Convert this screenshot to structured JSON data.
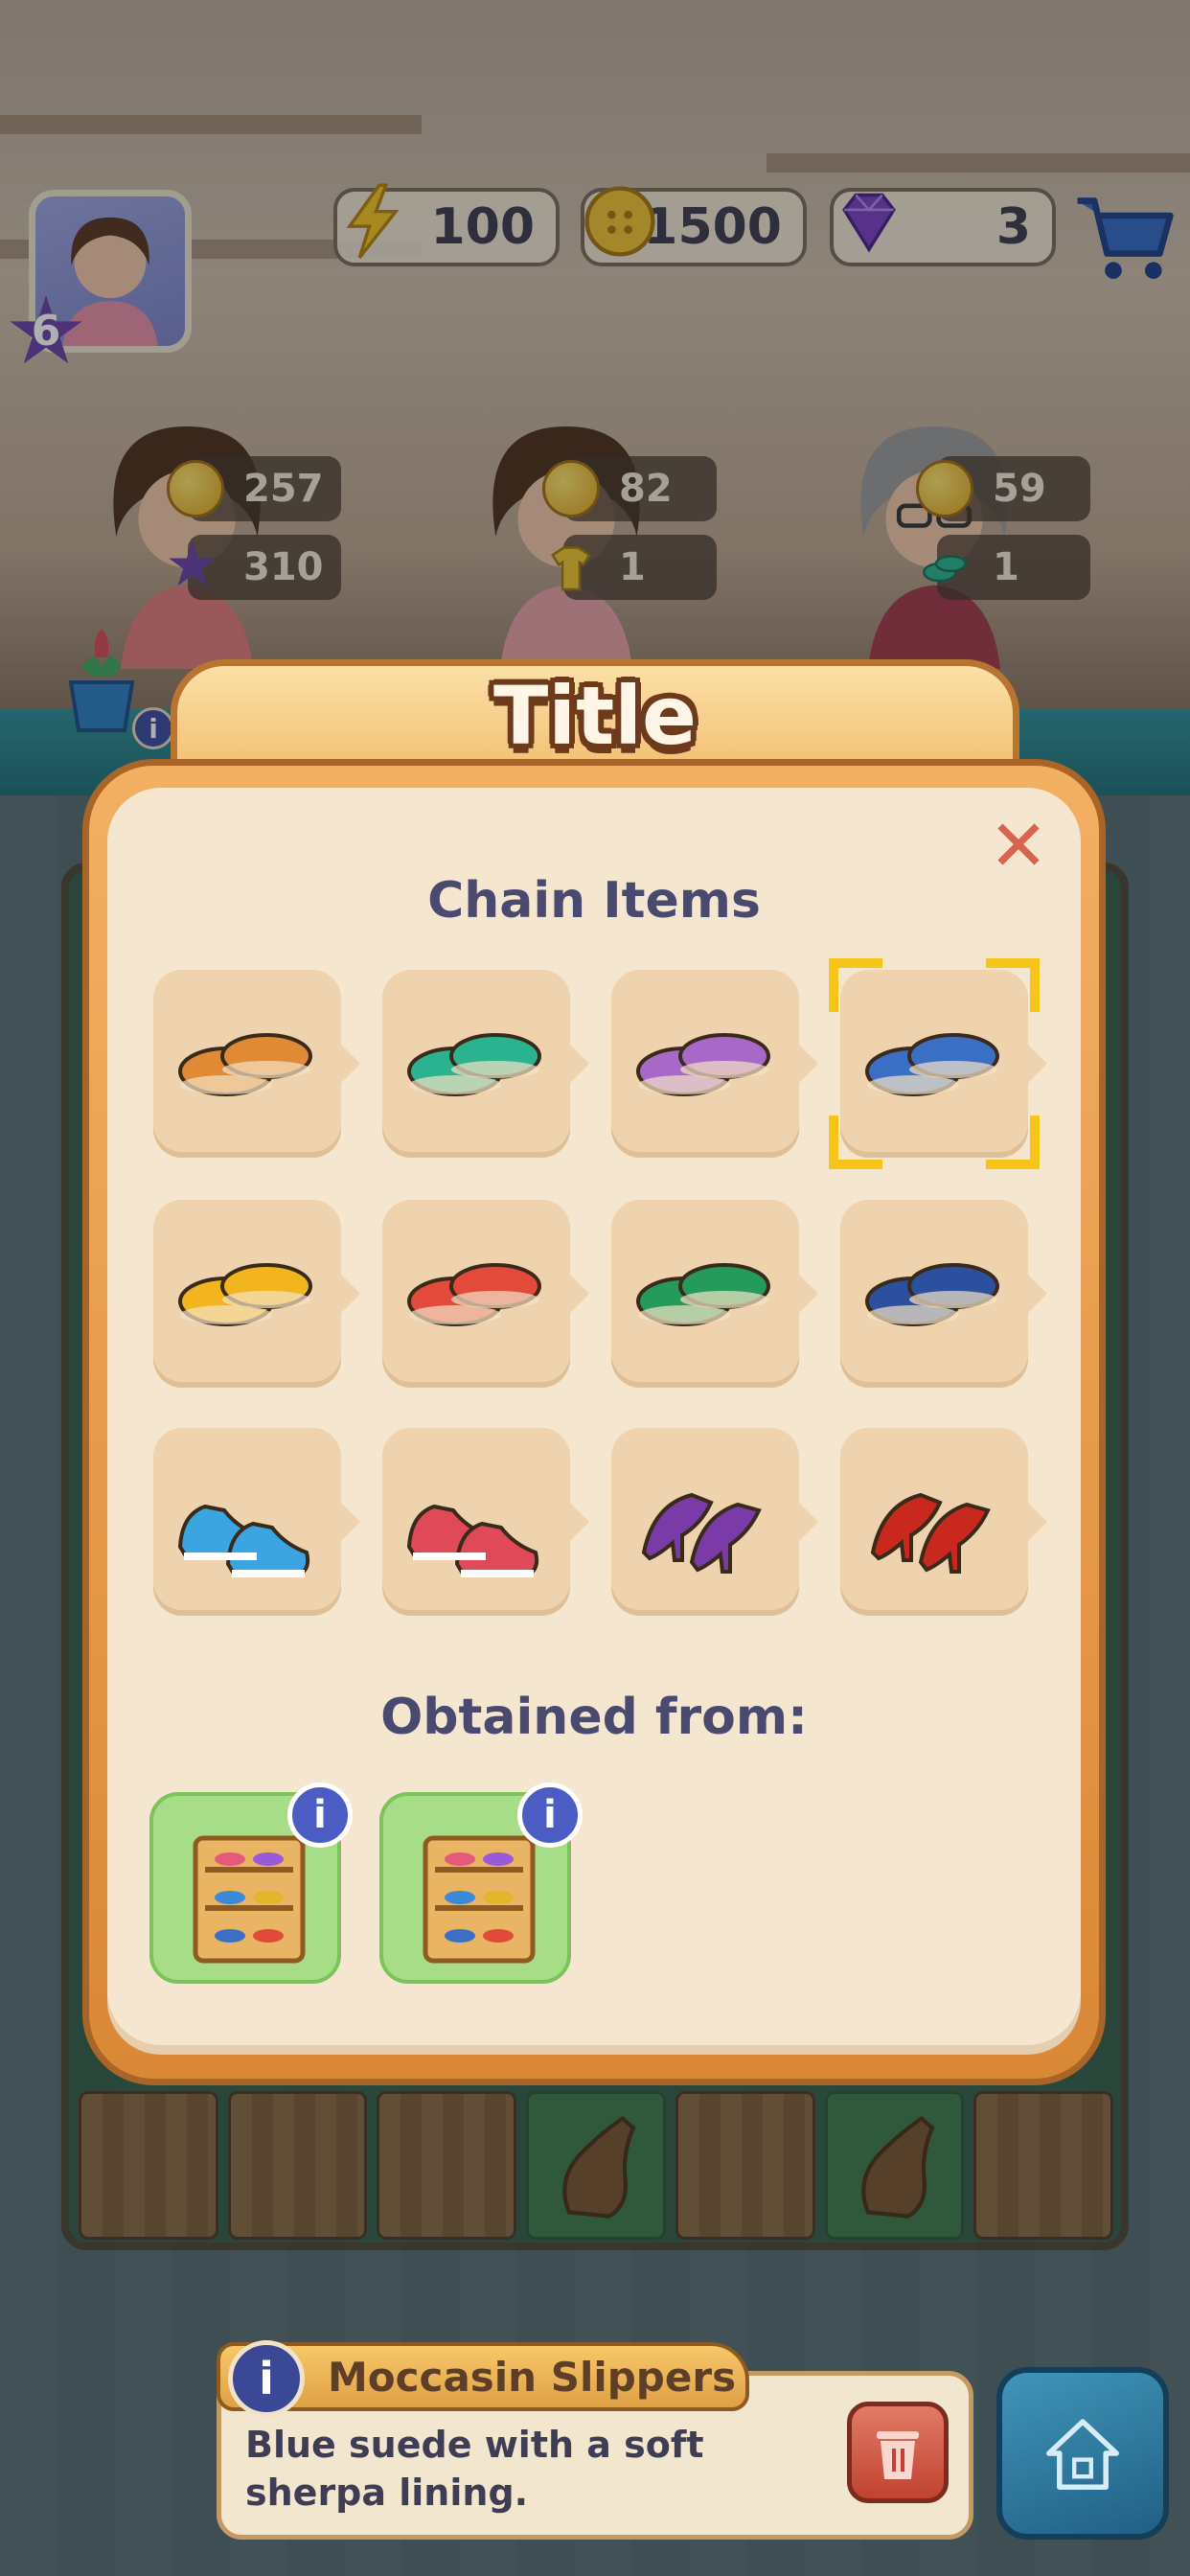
{
  "hud": {
    "level": "6",
    "energy": "100",
    "coins": "1500",
    "gems": "3"
  },
  "customers": [
    {
      "coin_reward": "257",
      "second_reward": "310"
    },
    {
      "coin_reward": "82",
      "second_reward": "1"
    },
    {
      "coin_reward": "59",
      "second_reward": "1"
    }
  ],
  "modal": {
    "title": "Title",
    "chain_heading": "Chain Items",
    "obtained_heading": "Obtained from:",
    "close_symbol": "✕",
    "chain_items": [
      {
        "icon": "orange-sandals-icon",
        "color": "#e08a35"
      },
      {
        "icon": "green-flower-slippers-icon",
        "color": "#2bb38f"
      },
      {
        "icon": "purple-slippers-icon",
        "color": "#a868c8"
      },
      {
        "icon": "blue-moccasin-slippers-icon",
        "color": "#3a6fc4",
        "selected": true
      },
      {
        "icon": "yellow-flats-icon",
        "color": "#f2b51e"
      },
      {
        "icon": "red-flats-icon",
        "color": "#e24a3c"
      },
      {
        "icon": "green-mary-janes-icon",
        "color": "#269a5a"
      },
      {
        "icon": "navy-slip-ons-icon",
        "color": "#2c4f9e"
      },
      {
        "icon": "blue-sneakers-icon",
        "color": "#3aa5e0"
      },
      {
        "icon": "red-high-top-sneakers-icon",
        "color": "#e04a58"
      },
      {
        "icon": "purple-heels-icon",
        "color": "#7a3aa8"
      },
      {
        "icon": "red-gold-heels-icon",
        "color": "#c8281e"
      }
    ],
    "sources": [
      {
        "icon": "shoe-rack-icon"
      },
      {
        "icon": "shoe-rack-icon"
      }
    ],
    "info_symbol": "i"
  },
  "item_description": {
    "name": "Moccasin Slippers",
    "text_line1": "Blue suede with a soft",
    "text_line2": "sherpa lining.",
    "info_symbol": "i"
  }
}
